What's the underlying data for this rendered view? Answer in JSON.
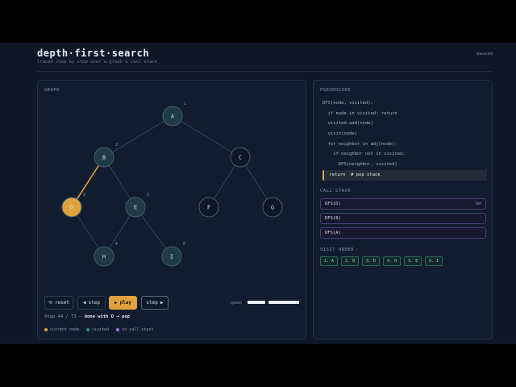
{
  "header": {
    "title": "depth·first·search",
    "subtitle": "traced step by step over a graph & call stack",
    "status": "paused"
  },
  "graph_panel": {
    "label": "GRAPH",
    "nodes": [
      {
        "id": "A",
        "order": "1",
        "state": "visited"
      },
      {
        "id": "B",
        "order": "2",
        "state": "visited"
      },
      {
        "id": "C",
        "order": "",
        "state": "unvisited"
      },
      {
        "id": "D",
        "order": "3",
        "state": "current"
      },
      {
        "id": "E",
        "order": "5",
        "state": "visited"
      },
      {
        "id": "F",
        "order": "",
        "state": "unvisited"
      },
      {
        "id": "G",
        "order": "",
        "state": "unvisited"
      },
      {
        "id": "H",
        "order": "4",
        "state": "visited"
      },
      {
        "id": "I",
        "order": "6",
        "state": "visited"
      }
    ],
    "edges": [
      {
        "from": "A",
        "to": "B",
        "active": false
      },
      {
        "from": "A",
        "to": "C",
        "active": false
      },
      {
        "from": "B",
        "to": "D",
        "active": true
      },
      {
        "from": "B",
        "to": "E",
        "active": false
      },
      {
        "from": "C",
        "to": "F",
        "active": false
      },
      {
        "from": "C",
        "to": "G",
        "active": false
      },
      {
        "from": "D",
        "to": "H",
        "active": false
      },
      {
        "from": "E",
        "to": "H",
        "active": false
      },
      {
        "from": "E",
        "to": "I",
        "active": false
      }
    ],
    "colors": {
      "current": "#e0a23c",
      "visited": "#1f3b45",
      "unvisited": "#0d1726",
      "call_stack": "#9d7be0"
    },
    "controls": {
      "reset": "reset",
      "step_back": "step",
      "play": "play",
      "step_forward": "step"
    },
    "speed_label": "speed",
    "step_text": {
      "prefix": "Step 44 / 73 —",
      "message": "done with D → pop"
    },
    "legend": [
      {
        "label": "current node",
        "color": "#e0a23c"
      },
      {
        "label": "visited",
        "color": "#2f8f82"
      },
      {
        "label": "on call stack",
        "color": "#9d7be0"
      }
    ]
  },
  "pseudocode": {
    "label": "PSEUDOCODE",
    "lines": [
      "DFS(node, visited):",
      "  if node in visited: return",
      "  visited.add(node)",
      "  visit(node)",
      "  for neighbor in adj[node]:",
      "    if neighbor not in visited:",
      "      DFS(neighbor, visited)",
      "  return  # pop stack"
    ],
    "highlight_index": 7
  },
  "call_stack": {
    "label": "CALL STACK",
    "top_badge": "TOP",
    "frames": [
      "DFS(D)",
      "DFS(B)",
      "DFS(A)"
    ]
  },
  "visit_order": {
    "label": "VISIT ORDER",
    "items": [
      "1. A",
      "2. B",
      "3. D",
      "4. H",
      "5. E",
      "6. I"
    ]
  }
}
